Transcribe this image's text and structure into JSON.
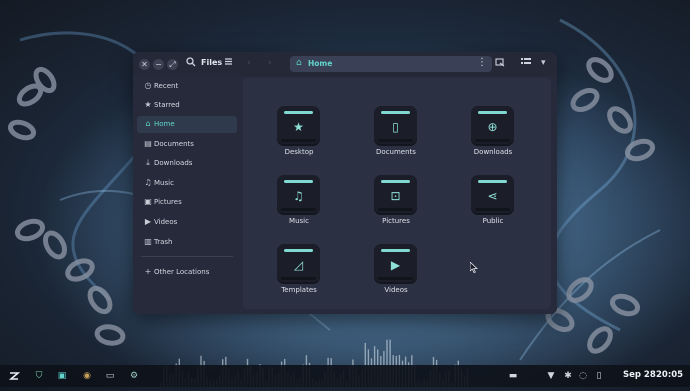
{
  "window": {
    "title": "Files",
    "location": "Home",
    "controls": {
      "close": "✕",
      "minimize": "−",
      "maximize": "⤢"
    },
    "toolbar_icons": {
      "search": "search-icon",
      "menu": "hamburger-menu-icon",
      "more": "⋮",
      "view": "list-view-icon",
      "dropdown": "▾"
    }
  },
  "sidebar": {
    "items": [
      {
        "label": "Recent",
        "icon": "clock-icon",
        "glyph": "◷"
      },
      {
        "label": "Starred",
        "icon": "star-icon",
        "glyph": "★"
      },
      {
        "label": "Home",
        "icon": "home-icon",
        "glyph": "⌂",
        "active": true
      },
      {
        "label": "Documents",
        "icon": "document-icon",
        "glyph": "▤"
      },
      {
        "label": "Downloads",
        "icon": "download-icon",
        "glyph": "⤓"
      },
      {
        "label": "Music",
        "icon": "music-icon",
        "glyph": "♫"
      },
      {
        "label": "Pictures",
        "icon": "picture-icon",
        "glyph": "▣"
      },
      {
        "label": "Videos",
        "icon": "video-icon",
        "glyph": "▶"
      },
      {
        "label": "Trash",
        "icon": "trash-icon",
        "glyph": "▥"
      }
    ],
    "other_locations": {
      "label": "Other Locations",
      "glyph": "+"
    }
  },
  "folders": [
    {
      "label": "Desktop",
      "icon": "star-icon",
      "glyph": "★"
    },
    {
      "label": "Documents",
      "icon": "document-icon",
      "glyph": "▯"
    },
    {
      "label": "Downloads",
      "icon": "download-icon",
      "glyph": "⊕"
    },
    {
      "label": "Music",
      "icon": "music-icon",
      "glyph": "♫"
    },
    {
      "label": "Pictures",
      "icon": "picture-icon",
      "glyph": "⊡"
    },
    {
      "label": "Public",
      "icon": "share-icon",
      "glyph": "⋖"
    },
    {
      "label": "Templates",
      "icon": "template-icon",
      "glyph": "◿"
    },
    {
      "label": "Videos",
      "icon": "play-icon",
      "glyph": "▶"
    }
  ],
  "taskbar": {
    "clock": {
      "date": "Sep 28",
      "time": "20:05"
    }
  },
  "colors": {
    "accent": "#62d4cd",
    "window_bg": "#262a3a",
    "content_bg": "#2b3042"
  }
}
